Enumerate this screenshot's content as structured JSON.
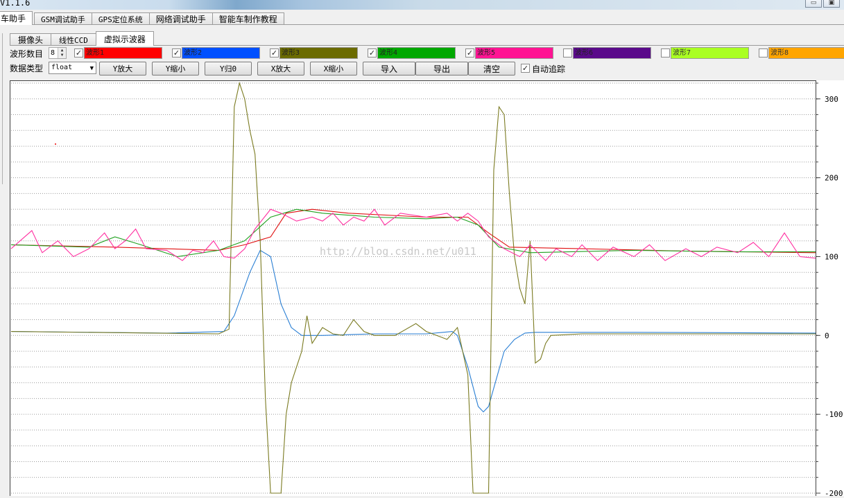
{
  "window": {
    "title": "V1.1.6",
    "buttons": [
      "minimize-button",
      "maximize-button"
    ]
  },
  "main_tabs": [
    {
      "label": "车助手",
      "active": true
    },
    {
      "label": "GSM调试助手",
      "active": false
    },
    {
      "label": "GPS定位系统",
      "active": false
    },
    {
      "label": "网络调试助手",
      "active": false
    },
    {
      "label": "智能车制作教程",
      "active": false
    }
  ],
  "sub_tabs": [
    {
      "label": "摄像头",
      "active": false
    },
    {
      "label": "线性CCD",
      "active": false
    },
    {
      "label": "虚拟示波器",
      "active": true
    }
  ],
  "controls": {
    "wave_count_label": "波形数目",
    "wave_count_value": "8",
    "data_type_label": "数据类型",
    "data_type_value": "float",
    "auto_track_label": "自动追踪",
    "auto_track_checked": true,
    "buttons": {
      "y_zoom_in": "Y放大",
      "y_zoom_out": "Y缩小",
      "y_reset": "Y归0",
      "x_zoom_in": "X放大",
      "x_zoom_out": "X缩小",
      "import": "导入",
      "export": "导出",
      "clear": "清空"
    }
  },
  "waveforms": [
    {
      "label": "波形1",
      "checked": true,
      "color": "#ff0000"
    },
    {
      "label": "波形2",
      "checked": true,
      "color": "#0050ff"
    },
    {
      "label": "波形3",
      "checked": true,
      "color": "#6b6b00"
    },
    {
      "label": "波形4",
      "checked": true,
      "color": "#00a800"
    },
    {
      "label": "波形5",
      "checked": true,
      "color": "#ff1493"
    },
    {
      "label": "波形6",
      "checked": false,
      "color": "#5a0a8a"
    },
    {
      "label": "波形7",
      "checked": false,
      "color": "#aaff22"
    },
    {
      "label": "波形8",
      "checked": false,
      "color": "#ffa500"
    }
  ],
  "watermark": "http://blog.csdn.net/u011",
  "chart_data": {
    "type": "line",
    "ylim": [
      -200,
      320
    ],
    "xlim": [
      0,
      155
    ],
    "yticks": [
      300,
      200,
      100,
      0,
      -100,
      -200
    ],
    "grid": true,
    "series": [
      {
        "color": "#e01010",
        "points": [
          [
            0,
            115
          ],
          [
            20,
            112
          ],
          [
            40,
            108
          ],
          [
            45,
            115
          ],
          [
            50,
            125
          ],
          [
            53,
            155
          ],
          [
            58,
            160
          ],
          [
            65,
            155
          ],
          [
            80,
            150
          ],
          [
            88,
            150
          ],
          [
            92,
            130
          ],
          [
            96,
            112
          ],
          [
            110,
            110
          ],
          [
            130,
            107
          ],
          [
            155,
            105
          ]
        ]
      },
      {
        "color": "#2a7fd4",
        "points": [
          [
            0,
            5
          ],
          [
            30,
            3
          ],
          [
            41,
            5
          ],
          [
            43,
            25
          ],
          [
            46,
            80
          ],
          [
            48,
            108
          ],
          [
            50,
            100
          ],
          [
            52,
            40
          ],
          [
            54,
            10
          ],
          [
            56,
            0
          ],
          [
            60,
            0
          ],
          [
            70,
            2
          ],
          [
            80,
            2
          ],
          [
            85,
            5
          ],
          [
            86,
            0
          ],
          [
            88,
            -40
          ],
          [
            90,
            -90
          ],
          [
            91,
            -97
          ],
          [
            92,
            -90
          ],
          [
            95,
            -20
          ],
          [
            97,
            -5
          ],
          [
            99,
            3
          ],
          [
            101,
            4
          ],
          [
            120,
            4
          ],
          [
            155,
            3
          ]
        ]
      },
      {
        "color": "#7a7a20",
        "points": [
          [
            0,
            5
          ],
          [
            40,
            2
          ],
          [
            42,
            8
          ],
          [
            43,
            290
          ],
          [
            44,
            320
          ],
          [
            45,
            300
          ],
          [
            46,
            260
          ],
          [
            47,
            230
          ],
          [
            48,
            120
          ],
          [
            49,
            -80
          ],
          [
            50,
            -200
          ],
          [
            51,
            -200
          ],
          [
            52,
            -200
          ],
          [
            53,
            -100
          ],
          [
            54,
            -60
          ],
          [
            55,
            -40
          ],
          [
            56,
            -20
          ],
          [
            57,
            25
          ],
          [
            58,
            -10
          ],
          [
            60,
            10
          ],
          [
            62,
            2
          ],
          [
            64,
            0
          ],
          [
            66,
            20
          ],
          [
            68,
            5
          ],
          [
            70,
            0
          ],
          [
            74,
            0
          ],
          [
            78,
            15
          ],
          [
            80,
            5
          ],
          [
            84,
            -5
          ],
          [
            86,
            10
          ],
          [
            88,
            -50
          ],
          [
            89,
            -200
          ],
          [
            92,
            -200
          ],
          [
            93,
            210
          ],
          [
            94,
            290
          ],
          [
            95,
            280
          ],
          [
            96,
            180
          ],
          [
            97,
            100
          ],
          [
            98,
            60
          ],
          [
            99,
            40
          ],
          [
            100,
            120
          ],
          [
            101,
            -35
          ],
          [
            102,
            -30
          ],
          [
            103,
            -10
          ],
          [
            104,
            0
          ],
          [
            110,
            2
          ],
          [
            155,
            2
          ]
        ]
      },
      {
        "color": "#1ea01e",
        "points": [
          [
            0,
            115
          ],
          [
            15,
            112
          ],
          [
            20,
            125
          ],
          [
            25,
            115
          ],
          [
            32,
            100
          ],
          [
            40,
            108
          ],
          [
            45,
            120
          ],
          [
            50,
            150
          ],
          [
            55,
            160
          ],
          [
            60,
            155
          ],
          [
            70,
            150
          ],
          [
            80,
            148
          ],
          [
            86,
            150
          ],
          [
            90,
            140
          ],
          [
            94,
            112
          ],
          [
            100,
            105
          ],
          [
            120,
            108
          ],
          [
            140,
            106
          ],
          [
            155,
            106
          ]
        ]
      },
      {
        "color": "#ff2fa0",
        "points": [
          [
            0,
            110
          ],
          [
            4,
            133
          ],
          [
            6,
            105
          ],
          [
            9,
            120
          ],
          [
            12,
            100
          ],
          [
            15,
            110
          ],
          [
            18,
            130
          ],
          [
            20,
            110
          ],
          [
            22,
            120
          ],
          [
            24,
            135
          ],
          [
            26,
            110
          ],
          [
            30,
            108
          ],
          [
            33,
            95
          ],
          [
            35,
            108
          ],
          [
            37,
            105
          ],
          [
            39,
            120
          ],
          [
            41,
            100
          ],
          [
            43,
            98
          ],
          [
            45,
            110
          ],
          [
            47,
            135
          ],
          [
            50,
            160
          ],
          [
            52,
            155
          ],
          [
            55,
            145
          ],
          [
            58,
            150
          ],
          [
            60,
            145
          ],
          [
            62,
            155
          ],
          [
            64,
            140
          ],
          [
            66,
            150
          ],
          [
            68,
            145
          ],
          [
            70,
            160
          ],
          [
            72,
            140
          ],
          [
            75,
            155
          ],
          [
            80,
            150
          ],
          [
            84,
            155
          ],
          [
            86,
            145
          ],
          [
            88,
            155
          ],
          [
            90,
            145
          ],
          [
            92,
            125
          ],
          [
            95,
            110
          ],
          [
            98,
            100
          ],
          [
            100,
            115
          ],
          [
            103,
            95
          ],
          [
            105,
            110
          ],
          [
            108,
            100
          ],
          [
            110,
            115
          ],
          [
            113,
            95
          ],
          [
            116,
            112
          ],
          [
            120,
            100
          ],
          [
            123,
            115
          ],
          [
            126,
            95
          ],
          [
            130,
            110
          ],
          [
            133,
            100
          ],
          [
            136,
            112
          ],
          [
            140,
            105
          ],
          [
            143,
            118
          ],
          [
            146,
            100
          ],
          [
            149,
            130
          ],
          [
            152,
            100
          ],
          [
            155,
            98
          ]
        ]
      }
    ]
  }
}
